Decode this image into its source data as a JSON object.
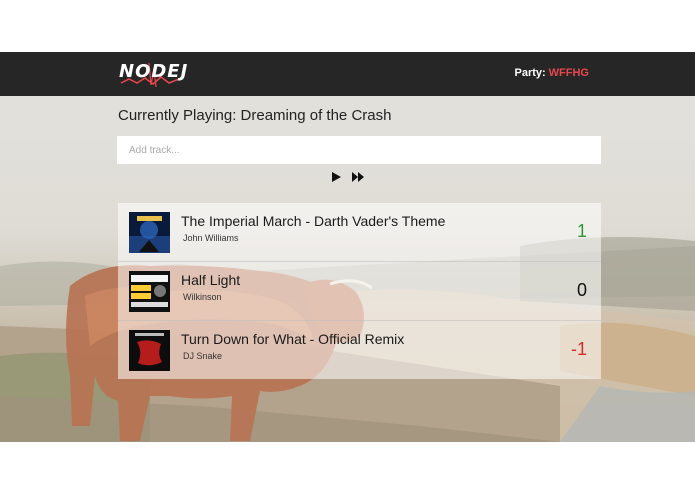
{
  "navbar": {
    "logo_text": "NODEJ",
    "party_label": "Party:",
    "party_code": "WFFHG"
  },
  "player": {
    "current_label": "Currently Playing: Dreaming of the Crash",
    "add_placeholder": "Add track...",
    "play_icon": "play-icon",
    "skip_icon": "fast-forward-icon"
  },
  "tracks": [
    {
      "title": "The Imperial March - Darth Vader's Theme",
      "artist": "John Williams",
      "score": "1",
      "score_color": "#2e9a34"
    },
    {
      "title": "Half Light",
      "artist": "Wilkinson",
      "score": "0",
      "score_color": "#111111"
    },
    {
      "title": "Turn Down for What - Official Remix",
      "artist": "DJ Snake",
      "score": "-1",
      "score_color": "#d62b2b"
    }
  ],
  "colors": {
    "navbar_bg": "#262626",
    "accent_red": "#e8474c"
  }
}
